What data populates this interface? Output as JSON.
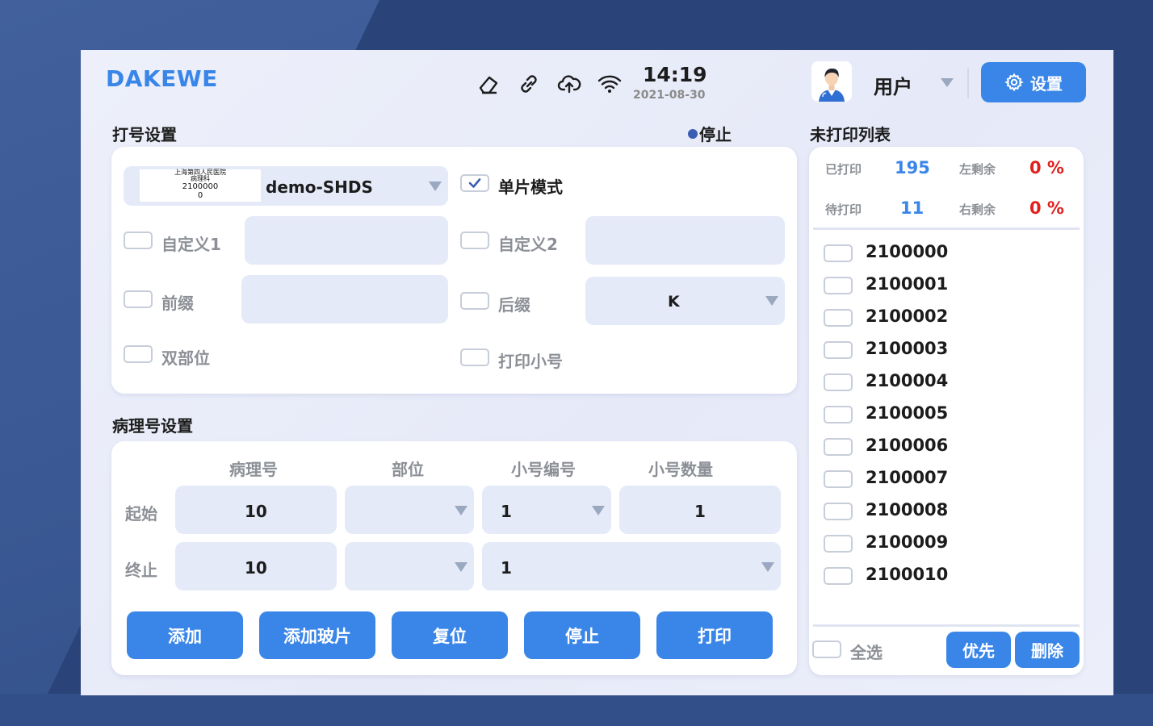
{
  "header": {
    "brand": "DAKEWE",
    "time": "14:19",
    "date": "2021-08-30",
    "user_label": "用户",
    "settings_label": "设置",
    "status_icons": [
      "eraser-icon",
      "link-icon",
      "cloud-upload-icon",
      "wifi-icon"
    ],
    "accent_color": "#3a86e8"
  },
  "print_settings": {
    "title": "打号设置",
    "status": "停止",
    "template": {
      "thumbnail_lines": [
        "上海第四人民医院",
        "病理科",
        "2100000",
        "0"
      ],
      "name": "demo-SHDS"
    },
    "single_mode": {
      "label": "单片模式",
      "checked": true
    },
    "custom1": {
      "label": "自定义1",
      "checked": false,
      "value": ""
    },
    "custom2": {
      "label": "自定义2",
      "checked": false,
      "value": ""
    },
    "prefix": {
      "label": "前缀",
      "checked": false,
      "value": ""
    },
    "suffix": {
      "label": "后缀",
      "checked": false,
      "value": "K"
    },
    "double_part": {
      "label": "双部位",
      "checked": false
    },
    "print_small": {
      "label": "打印小号",
      "checked": false
    }
  },
  "pathology_settings": {
    "title": "病理号设置",
    "columns": [
      "病理号",
      "部位",
      "小号编号",
      "小号数量"
    ],
    "start": {
      "label": "起始",
      "pathology_no": "10",
      "part": "",
      "small_no": "1",
      "small_count": "1"
    },
    "end": {
      "label": "终止",
      "pathology_no": "10",
      "part": "",
      "small_no": "1"
    },
    "buttons": [
      "添加",
      "添加玻片",
      "复位",
      "停止",
      "打印"
    ]
  },
  "unprinted_list": {
    "title": "未打印列表",
    "printed_label": "已打印",
    "printed_value": "195",
    "pending_label": "待打印",
    "pending_value": "11",
    "left_remaining_label": "左剩余",
    "left_remaining_value": "0 %",
    "right_remaining_label": "右剩余",
    "right_remaining_value": "0 %",
    "items": [
      "2100000",
      "2100001",
      "2100002",
      "2100003",
      "2100004",
      "2100005",
      "2100006",
      "2100007",
      "2100008",
      "2100009",
      "2100010"
    ],
    "select_all_label": "全选",
    "priority_label": "优先",
    "delete_label": "删除",
    "red_color": "#e0201e"
  }
}
